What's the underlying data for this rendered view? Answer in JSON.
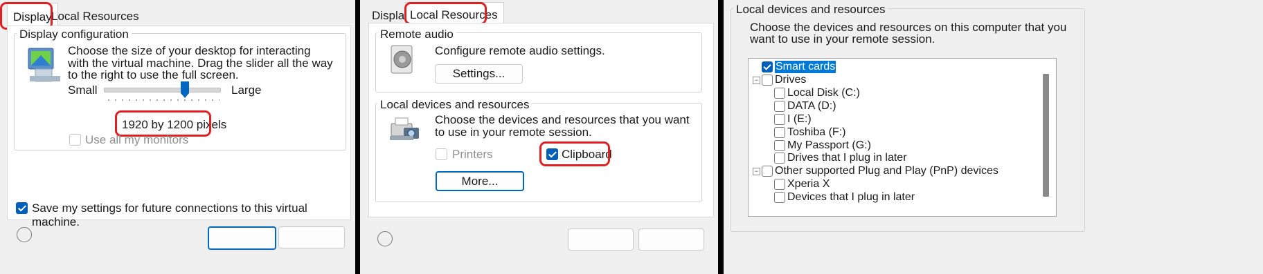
{
  "panel1": {
    "tabs": [
      {
        "label": "Display"
      },
      {
        "label": "Local Resources"
      }
    ],
    "group_title": "Display configuration",
    "description": "Choose the size of your desktop for interacting with the virtual machine. Drag the slider all the way to the right to use the full screen.",
    "slider": {
      "min_label": "Small",
      "max_label": "Large",
      "value_text": "1920 by 1200 pixels",
      "position": 0.72
    },
    "use_all_monitors": {
      "label": "Use all my monitors",
      "checked": false,
      "enabled": false
    },
    "save_settings": {
      "label": "Save my settings for future connections to this virtual machine.",
      "checked": true
    },
    "icons": {
      "display": "monitor-icon"
    }
  },
  "panel2": {
    "tabs": [
      {
        "label": "Display"
      },
      {
        "label": "Local Resources"
      }
    ],
    "remote_audio": {
      "title": "Remote audio",
      "description": "Configure remote audio settings.",
      "button": "Settings..."
    },
    "local_devices": {
      "title": "Local devices and resources",
      "description": "Choose the devices and resources that you want to use in your remote session.",
      "printers": {
        "label": "Printers",
        "checked": false,
        "enabled": false
      },
      "clipboard": {
        "label": "Clipboard",
        "checked": true
      },
      "more_button": "More..."
    },
    "icons": {
      "audio": "speaker-icon",
      "devices": "printer-camera-icon"
    }
  },
  "panel3": {
    "group_title": "Local devices and resources",
    "description": "Choose the devices and resources on this computer that you want to use in your remote session.",
    "tree": {
      "smart_cards": {
        "label": "Smart cards",
        "checked": true
      },
      "drives": {
        "label": "Drives",
        "children": [
          {
            "label": "Local Disk (C:)"
          },
          {
            "label": "DATA (D:)"
          },
          {
            "label": "I (E:)"
          },
          {
            "label": "Toshiba (F:)"
          },
          {
            "label": "My Passport (G:)"
          },
          {
            "label": "Drives that I plug in later"
          }
        ]
      },
      "pnp": {
        "label": "Other supported Plug and Play (PnP) devices",
        "children": [
          {
            "label": "Xperia X"
          },
          {
            "label": "Devices that I plug in later"
          }
        ]
      }
    }
  },
  "colors": {
    "accent": "#005fb8",
    "highlight": "#e02020",
    "selection": "#0078d4"
  }
}
